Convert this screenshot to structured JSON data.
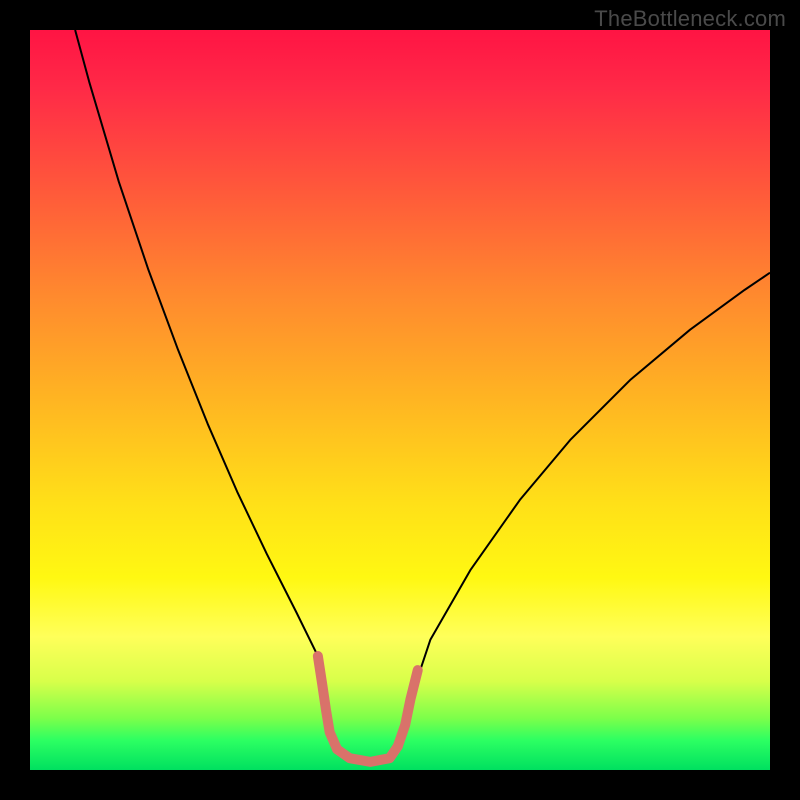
{
  "watermark": "TheBottleneck.com",
  "chart_data": {
    "type": "line",
    "title": "",
    "xlabel": "",
    "ylabel": "",
    "xlim": [
      0,
      100
    ],
    "ylim": [
      0,
      100
    ],
    "gradient_stops": [
      {
        "pct": 0,
        "color": "#ff1444"
      },
      {
        "pct": 22,
        "color": "#ff5a3a"
      },
      {
        "pct": 50,
        "color": "#ffb522"
      },
      {
        "pct": 74,
        "color": "#fff812"
      },
      {
        "pct": 88,
        "color": "#d8ff4a"
      },
      {
        "pct": 100,
        "color": "#00e060"
      }
    ],
    "series": [
      {
        "name": "left-branch",
        "stroke": "#000000",
        "stroke_width": 2,
        "points": [
          {
            "x": 6.1,
            "y": 100.0
          },
          {
            "x": 8.0,
            "y": 93.0
          },
          {
            "x": 12.0,
            "y": 79.5
          },
          {
            "x": 16.0,
            "y": 67.6
          },
          {
            "x": 20.0,
            "y": 56.8
          },
          {
            "x": 24.0,
            "y": 46.8
          },
          {
            "x": 28.0,
            "y": 37.6
          },
          {
            "x": 32.0,
            "y": 29.2
          },
          {
            "x": 36.0,
            "y": 21.3
          },
          {
            "x": 38.9,
            "y": 15.4
          },
          {
            "x": 39.5,
            "y": 11.5
          },
          {
            "x": 40.0,
            "y": 8.1
          },
          {
            "x": 40.5,
            "y": 5.1
          },
          {
            "x": 41.5,
            "y": 2.8
          },
          {
            "x": 43.2,
            "y": 1.6
          },
          {
            "x": 46.0,
            "y": 1.1
          },
          {
            "x": 48.6,
            "y": 1.6
          },
          {
            "x": 49.7,
            "y": 3.2
          },
          {
            "x": 50.7,
            "y": 6.1
          },
          {
            "x": 51.4,
            "y": 9.5
          }
        ]
      },
      {
        "name": "right-branch",
        "stroke": "#000000",
        "stroke_width": 2,
        "points": [
          {
            "x": 51.4,
            "y": 9.5
          },
          {
            "x": 54.1,
            "y": 17.6
          },
          {
            "x": 59.5,
            "y": 27.0
          },
          {
            "x": 66.2,
            "y": 36.5
          },
          {
            "x": 73.0,
            "y": 44.6
          },
          {
            "x": 81.1,
            "y": 52.7
          },
          {
            "x": 89.2,
            "y": 59.5
          },
          {
            "x": 96.6,
            "y": 64.9
          },
          {
            "x": 100.0,
            "y": 67.2
          }
        ]
      },
      {
        "name": "highlight-left-stub",
        "stroke": "#d9726a",
        "stroke_width": 10,
        "linecap": "round",
        "points": [
          {
            "x": 38.9,
            "y": 15.4
          },
          {
            "x": 39.5,
            "y": 11.5
          },
          {
            "x": 40.0,
            "y": 8.1
          },
          {
            "x": 40.5,
            "y": 5.1
          },
          {
            "x": 41.5,
            "y": 2.8
          }
        ]
      },
      {
        "name": "highlight-valley",
        "stroke": "#d9726a",
        "stroke_width": 10,
        "linecap": "round",
        "points": [
          {
            "x": 41.5,
            "y": 2.8
          },
          {
            "x": 43.2,
            "y": 1.6
          },
          {
            "x": 46.0,
            "y": 1.1
          },
          {
            "x": 48.6,
            "y": 1.6
          },
          {
            "x": 49.7,
            "y": 3.2
          }
        ]
      },
      {
        "name": "highlight-right-stub",
        "stroke": "#d9726a",
        "stroke_width": 10,
        "linecap": "round",
        "points": [
          {
            "x": 49.7,
            "y": 3.2
          },
          {
            "x": 50.7,
            "y": 6.1
          },
          {
            "x": 51.4,
            "y": 9.5
          },
          {
            "x": 52.4,
            "y": 13.5
          }
        ]
      }
    ]
  }
}
